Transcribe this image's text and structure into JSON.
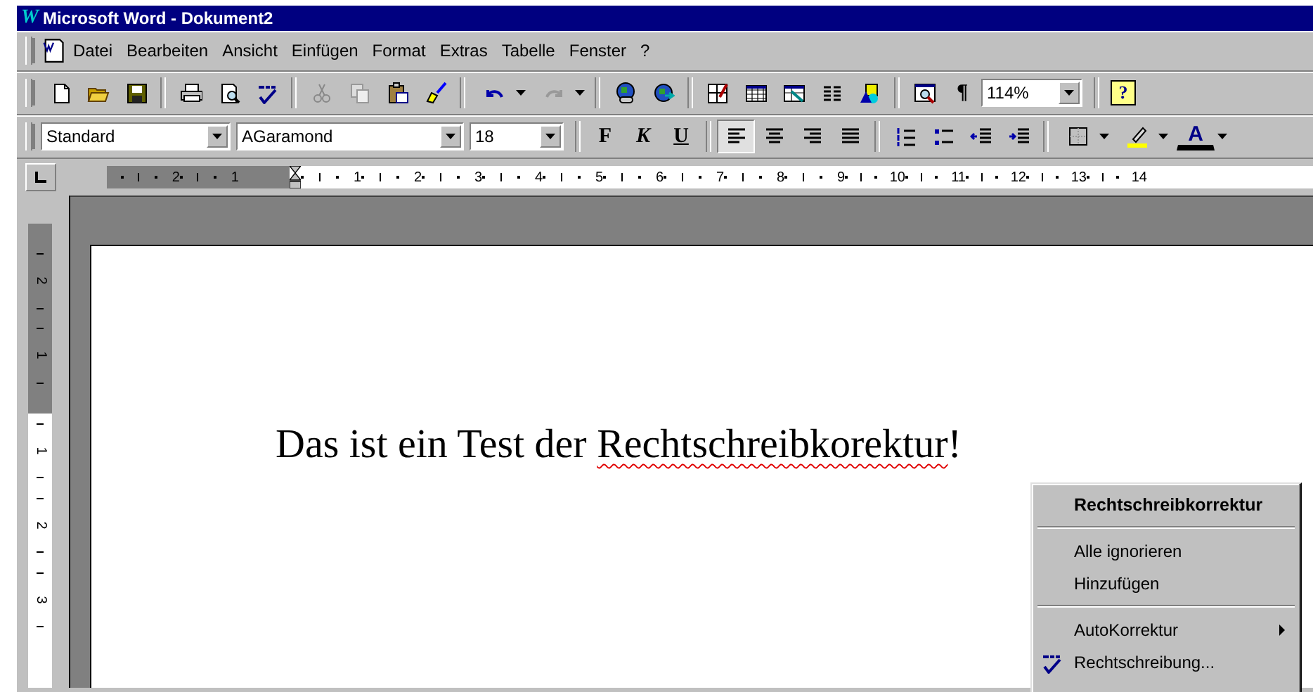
{
  "window": {
    "logo": "W",
    "title": "Microsoft Word - Dokument2"
  },
  "menu": [
    "Datei",
    "Bearbeiten",
    "Ansicht",
    "Einfügen",
    "Format",
    "Extras",
    "Tabelle",
    "Fenster",
    "?"
  ],
  "standard_toolbar": {
    "pilcrow": "¶",
    "zoom": "114%",
    "help": "?"
  },
  "format_toolbar": {
    "style": "Standard",
    "font": "AGaramond",
    "size": "18",
    "bold": "F",
    "italic": "K",
    "underline": "U",
    "font_color": "A",
    "alignment": [
      {
        "kind": "left",
        "selected": true
      },
      {
        "kind": "center",
        "selected": false
      },
      {
        "kind": "right",
        "selected": false
      },
      {
        "kind": "justify",
        "selected": false
      }
    ]
  },
  "ruler": {
    "left_labels": [
      "2",
      "1"
    ],
    "labels": [
      "1",
      "2",
      "3",
      "4",
      "5",
      "6",
      "7",
      "8",
      "9",
      "10",
      "11",
      "12",
      "13",
      "14"
    ]
  },
  "vertical_ruler": {
    "top_labels": [
      "2",
      "1"
    ],
    "labels": [
      "1",
      "2",
      "3"
    ]
  },
  "document": {
    "text_before": "Das ist ein Test der ",
    "misspelled": "Rechtschreibkorektur",
    "text_after": "!"
  },
  "context_menu": {
    "items": [
      {
        "kind": "header",
        "label": "Rechtschreibkorrektur"
      },
      {
        "kind": "separator"
      },
      {
        "kind": "item",
        "label": "Alle ignorieren"
      },
      {
        "kind": "item",
        "label": "Hinzufügen"
      },
      {
        "kind": "separator"
      },
      {
        "kind": "submenu",
        "label": "AutoKorrektur"
      },
      {
        "kind": "spelling",
        "label": "Rechtschreibung..."
      }
    ]
  }
}
